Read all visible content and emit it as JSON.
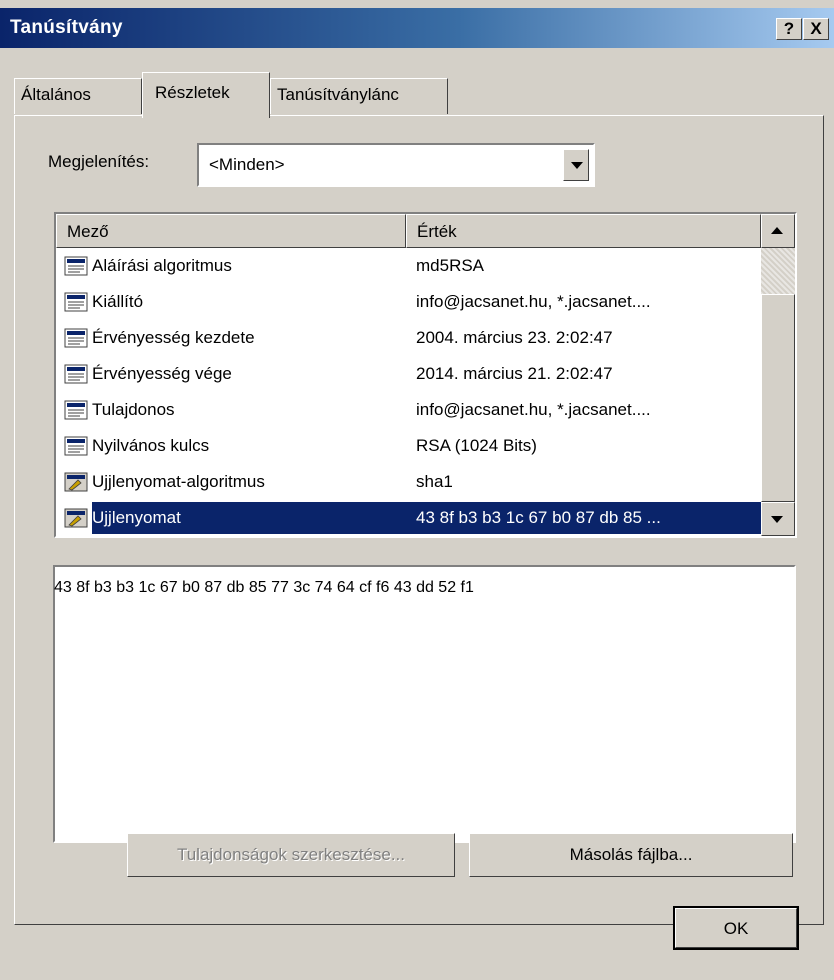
{
  "window": {
    "title": "Tanúsítvány",
    "help_button": "?",
    "close_button": "X"
  },
  "tabs": [
    {
      "label": "Általános",
      "active": false
    },
    {
      "label": "Részletek",
      "active": true
    },
    {
      "label": "Tanúsítványlánc",
      "active": false
    }
  ],
  "display": {
    "label": "Megjelenítés:",
    "selected": "<Minden>"
  },
  "list": {
    "columns": {
      "field": "Mező",
      "value": "Érték"
    },
    "rows": [
      {
        "field": "Aláírási algoritmus",
        "value": "md5RSA",
        "icon": "certificate-field-icon"
      },
      {
        "field": "Kiállító",
        "value": "info@jacsanet.hu, *.jacsanet....",
        "icon": "certificate-field-icon"
      },
      {
        "field": "Érvényesség kezdete",
        "value": "2004. március 23. 2:02:47",
        "icon": "certificate-field-icon"
      },
      {
        "field": "Érvényesség vége",
        "value": "2014. március 21. 2:02:47",
        "icon": "certificate-field-icon"
      },
      {
        "field": "Tulajdonos",
        "value": "info@jacsanet.hu, *.jacsanet....",
        "icon": "certificate-field-icon"
      },
      {
        "field": "Nyilvános kulcs",
        "value": "RSA (1024 Bits)",
        "icon": "certificate-field-icon"
      },
      {
        "field": "Ujjlenyomat-algoritmus",
        "value": "sha1",
        "icon": "property-field-icon"
      },
      {
        "field": "Ujjlenyomat",
        "value": "43 8f b3 b3 1c 67 b0 87 db 85 ...",
        "icon": "property-field-icon",
        "selected": true
      }
    ]
  },
  "detail_text": "43 8f b3 b3 1c 67 b0 87 db 85 77 3c 74 64 cf f6 43 dd 52 f1",
  "buttons": {
    "edit_properties": "Tulajdonságok szerkesztése...",
    "copy_to_file": "Másolás fájlba...",
    "ok": "OK"
  },
  "colors": {
    "title_bar": "#0a246a",
    "selection": "#0a246a",
    "face": "#d4d0c8"
  }
}
